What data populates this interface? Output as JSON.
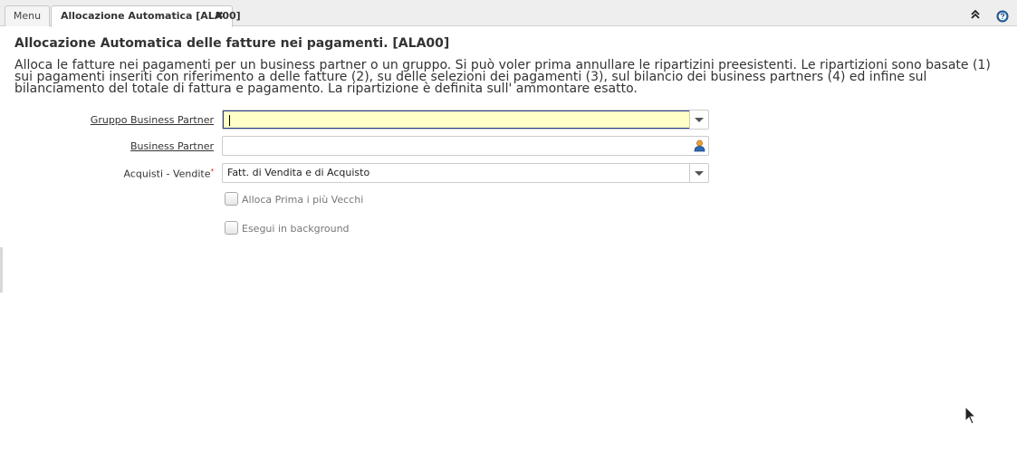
{
  "tabs": {
    "menu_label": "Menu",
    "active_label": "Allocazione Automatica [ALA00]",
    "close_glyph": "✖"
  },
  "toolbar": {
    "collapse_glyph": "⌃⌃",
    "collapse_icon": "double-chevron-up-icon",
    "help_icon": "help-icon"
  },
  "form": {
    "title": "Allocazione Automatica delle fatture nei pagamenti. [ALA00]",
    "description": "Alloca le fatture nei pagamenti per un business partner o un gruppo. Si può voler prima annullare le ripartizini preesistenti. Le ripartizioni sono basate (1) sui pagamenti inseriti con riferimento a delle fatture (2), su delle selezioni dei pagamenti (3), sul bilancio dei business partners (4) ed infine sul bilanciamento del totale di fattura e pagamento. La ripartizione è definita sull' ammontare esatto.",
    "fields": {
      "bp_group": {
        "label": "Gruppo Business Partner",
        "value": ""
      },
      "bp": {
        "label": "Business Partner",
        "value": ""
      },
      "so_po": {
        "label": "Acquisti - Vendite",
        "required_mark": "*",
        "value": "Fatt. di Vendita e di Acquisto"
      },
      "oldest_first": {
        "label": "Alloca Prima i più Vecchi",
        "checked": false
      },
      "background": {
        "label": "Esegui in background",
        "checked": false
      }
    }
  },
  "colors": {
    "required_field_bg": "#ffffc8",
    "focus_border": "#2a3d8f",
    "tab_bar_bg": "#eeeeee"
  }
}
